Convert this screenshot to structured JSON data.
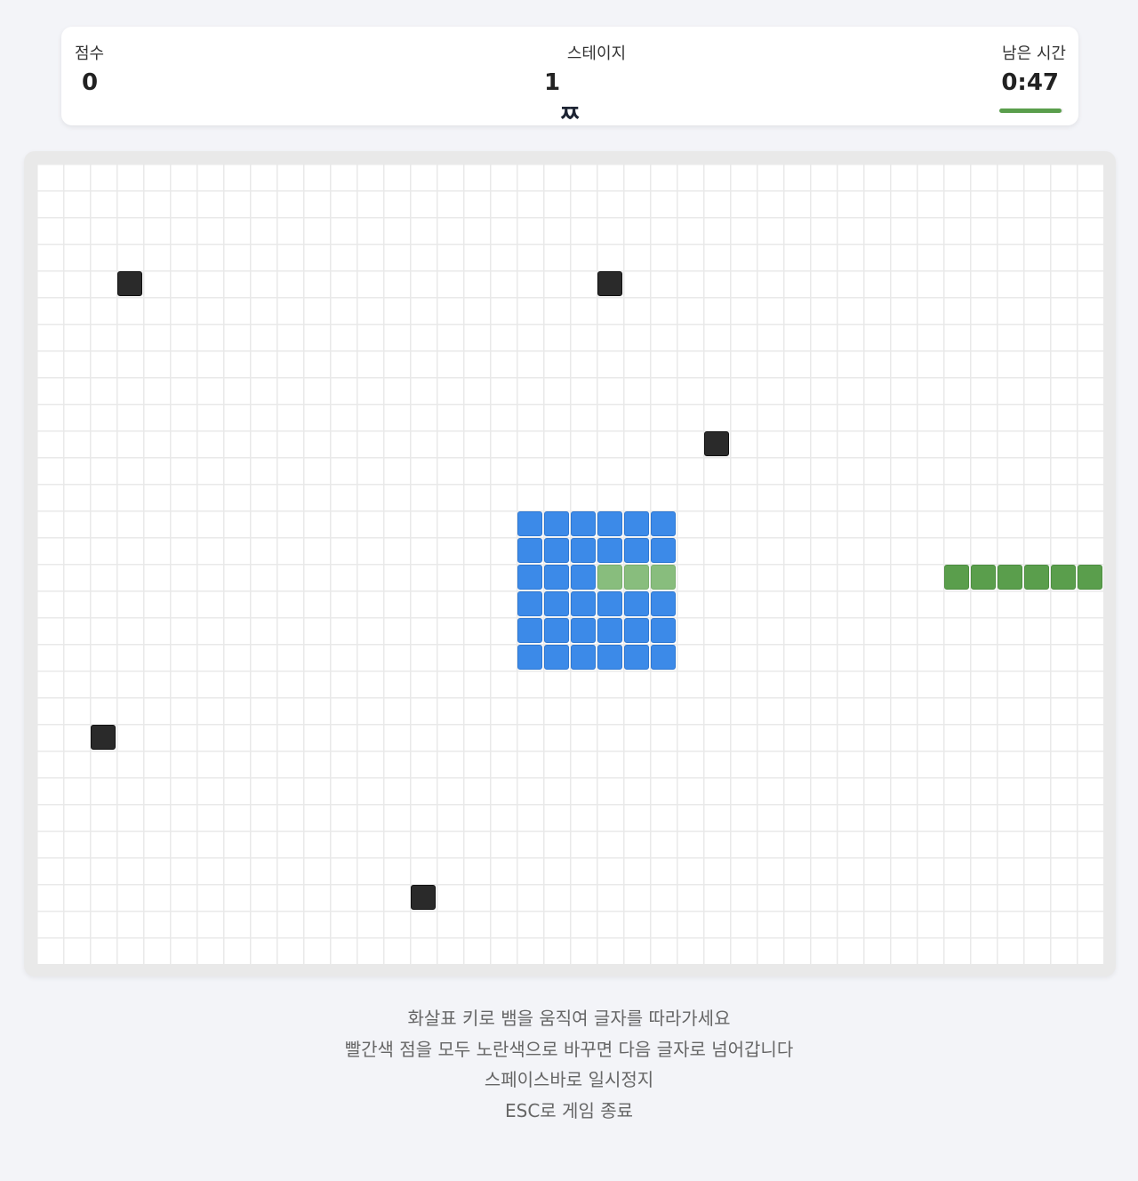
{
  "hud": {
    "score_label": "점수",
    "score_value": "0",
    "stage_label": "스테이지",
    "stage_value": "1",
    "target_char": "ㅉ",
    "time_label": "남은 시간",
    "time_value": "0:47",
    "time_remaining_fraction": 0.97
  },
  "board": {
    "columns": 40,
    "rows": 30,
    "obstacles": [
      {
        "col": 3,
        "row": 4
      },
      {
        "col": 21,
        "row": 4
      },
      {
        "col": 25,
        "row": 10
      },
      {
        "col": 2,
        "row": 21
      },
      {
        "col": 14,
        "row": 27
      }
    ],
    "target_area": {
      "col": 18,
      "row": 13,
      "width": 6,
      "height": 6
    },
    "filled_cells": [
      {
        "col": 21,
        "row": 15
      },
      {
        "col": 22,
        "row": 15
      },
      {
        "col": 23,
        "row": 15
      }
    ],
    "snake": [
      {
        "col": 34,
        "row": 15
      },
      {
        "col": 35,
        "row": 15
      },
      {
        "col": 36,
        "row": 15
      },
      {
        "col": 37,
        "row": 15
      },
      {
        "col": 38,
        "row": 15
      },
      {
        "col": 39,
        "row": 15
      }
    ]
  },
  "instructions": [
    "화살표 키로 뱀을 움직여 글자를 따라가세요",
    "빨간색 점을 모두 노란색으로 바꾸면 다음 글자로 넘어갑니다",
    "스페이스바로 일시정지",
    "ESC로 게임 종료"
  ],
  "colors": {
    "obstacle": "#2a2a2a",
    "target": "#3c8ae8",
    "filled": "#88bd7d",
    "snake": "#5a9e4c"
  }
}
